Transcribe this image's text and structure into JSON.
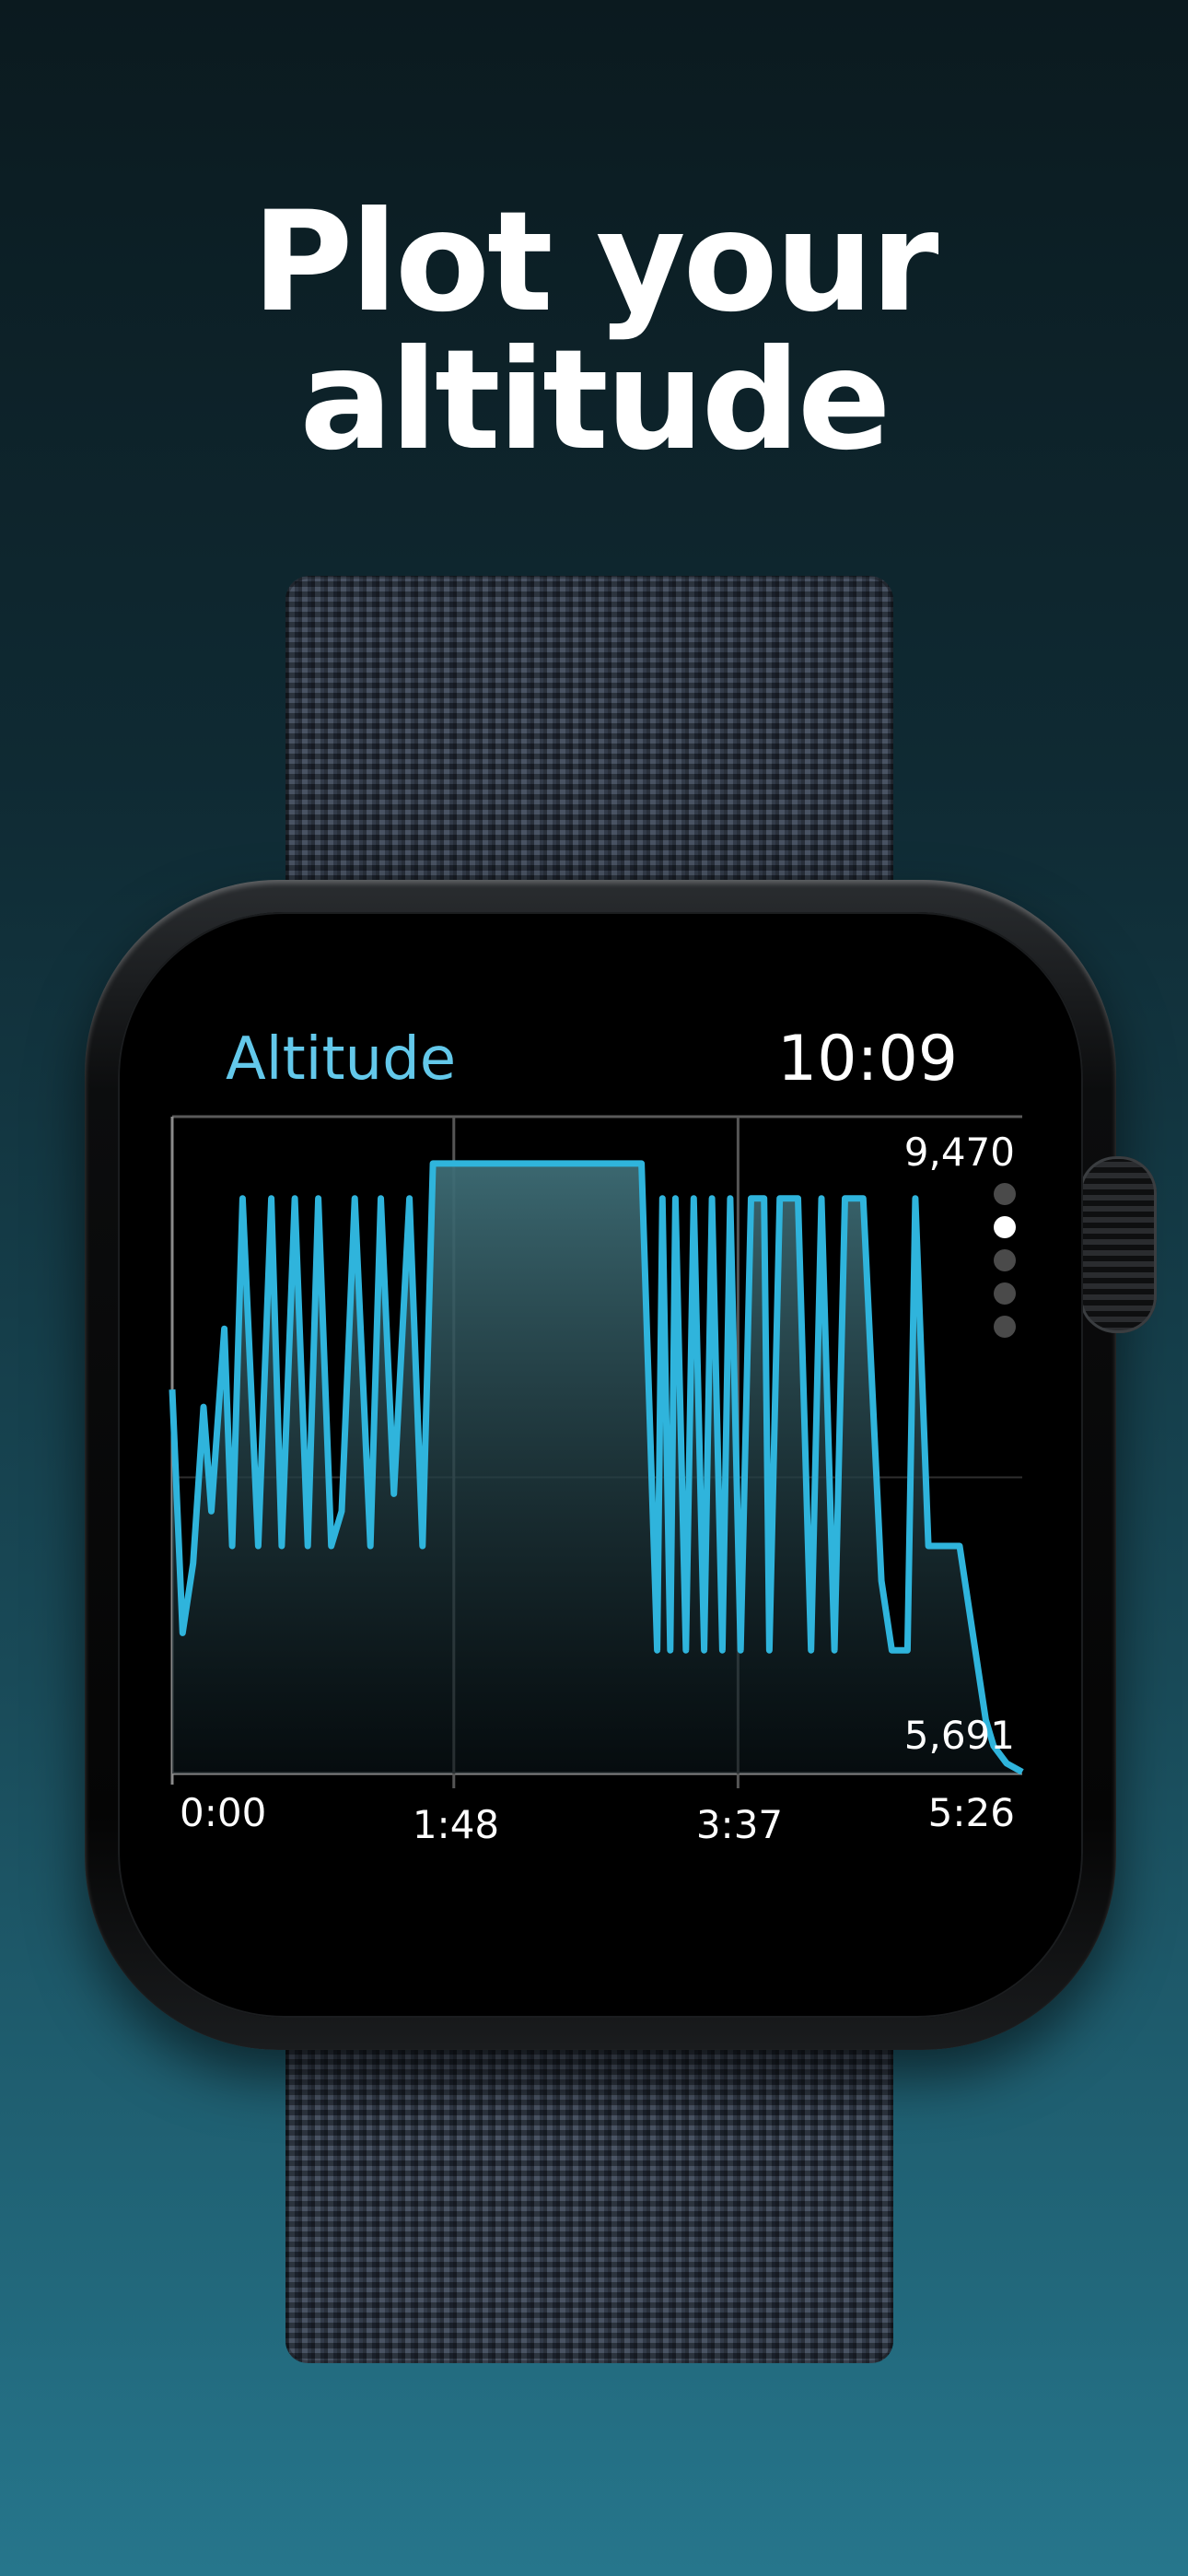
{
  "headline": "Plot your altitude",
  "watch": {
    "app_title": "Altitude",
    "time": "10:09",
    "page_indicator": {
      "pages": 5,
      "current": 2
    }
  },
  "colors": {
    "accent": "#63c8ea",
    "line": "#2fb4dc",
    "background_bottom": "#26768c",
    "background_top": "#0b1a1f"
  },
  "chart_data": {
    "type": "area",
    "y_max_label": "9,470",
    "y_min_label": "5,691",
    "ylim": [
      5691,
      9470
    ],
    "x_tick_labels": [
      "0:00",
      "1:48",
      "3:37",
      "5:26"
    ],
    "grid": true,
    "series": [
      {
        "x": [
          "0:00",
          "0:04",
          "0:08",
          "0:12",
          "0:15",
          "0:20",
          "0:23",
          "0:27",
          "0:33",
          "0:38",
          "0:42",
          "0:47",
          "0:52",
          "0:56",
          "1:01",
          "1:05",
          "1:10",
          "1:16",
          "1:20",
          "1:25",
          "1:31",
          "1:36",
          "1:40",
          "1:45",
          "1:50",
          "1:52",
          "1:56",
          "2:00",
          "2:20",
          "2:40",
          "3:00",
          "3:06",
          "3:08",
          "3:11",
          "3:13",
          "3:17",
          "3:20",
          "3:24",
          "3:27",
          "3:31",
          "3:34",
          "3:38",
          "3:42",
          "3:47",
          "3:49",
          "3:53",
          "4:00",
          "4:05",
          "4:09",
          "4:14",
          "4:18",
          "4:25",
          "4:32",
          "4:36",
          "4:42",
          "4:45",
          "4:50",
          "5:02",
          "5:10",
          "5:12",
          "5:15",
          "5:20",
          "5:26"
        ],
        "y": [
          7900,
          6500,
          6900,
          7800,
          7200,
          8250,
          7000,
          9000,
          7000,
          9000,
          7000,
          9000,
          7000,
          9000,
          7000,
          7200,
          9000,
          7000,
          9000,
          7300,
          9000,
          7000,
          9200,
          9200,
          9200,
          9200,
          9200,
          9200,
          9200,
          9200,
          9200,
          6400,
          9000,
          6400,
          9000,
          6400,
          9000,
          6400,
          9000,
          6400,
          9000,
          6400,
          9000,
          9000,
          6400,
          9000,
          9000,
          6400,
          9000,
          6400,
          9000,
          9000,
          6800,
          6400,
          6400,
          9000,
          7000,
          7000,
          6200,
          6000,
          5850,
          5750,
          5700
        ]
      }
    ]
  }
}
